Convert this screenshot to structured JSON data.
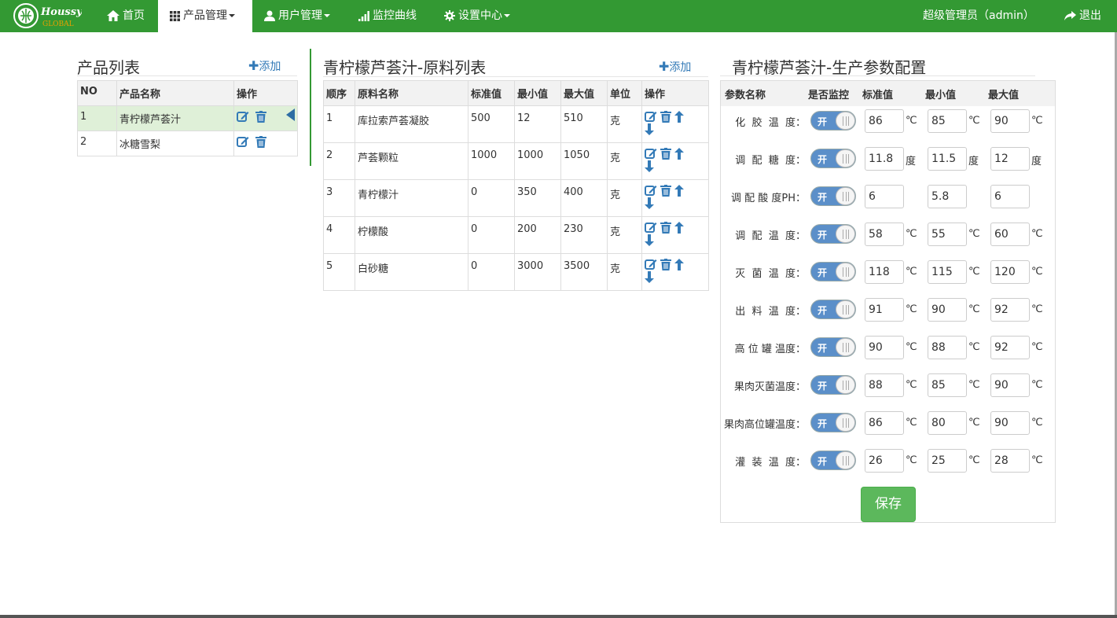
{
  "brand": {
    "logo_text": "Houssy",
    "logo_sub": "GLOBAL"
  },
  "nav": {
    "home": "首页",
    "product": "产品管理",
    "user": "用户管理",
    "monitor": "监控曲线",
    "settings": "设置中心",
    "admin": "超级管理员（admin）",
    "logout": "退出"
  },
  "products": {
    "title": "产品列表",
    "add": "添加",
    "headers": [
      "NO",
      "产品名称",
      "操作"
    ],
    "rows": [
      {
        "no": "1",
        "name": "青柠檬芦荟汁"
      },
      {
        "no": "2",
        "name": "冰糖雪梨"
      }
    ]
  },
  "materials": {
    "title": "青柠檬芦荟汁-原料列表",
    "add": "添加",
    "headers": [
      "顺序",
      "原料名称",
      "标准值",
      "最小值",
      "最大值",
      "单位",
      "操作"
    ],
    "rows": [
      {
        "seq": "1",
        "name": "库拉索芦荟凝胶",
        "std": "500",
        "min": "12",
        "max": "510",
        "unit": "克"
      },
      {
        "seq": "2",
        "name": "芦荟颗粒",
        "std": "1000",
        "min": "1000",
        "max": "1050",
        "unit": "克"
      },
      {
        "seq": "3",
        "name": "青柠檬汁",
        "std": "0",
        "min": "350",
        "max": "400",
        "unit": "克"
      },
      {
        "seq": "4",
        "name": "柠檬酸",
        "std": "0",
        "min": "200",
        "max": "230",
        "unit": "克"
      },
      {
        "seq": "5",
        "name": "白砂糖",
        "std": "0",
        "min": "3000",
        "max": "3500",
        "unit": "克"
      }
    ]
  },
  "params": {
    "title": "青柠檬芦荟汁-生产参数配置",
    "headers": [
      "参数名称",
      "是否监控",
      "标准值",
      "最小值",
      "最大值"
    ],
    "toggle_label": "开",
    "rows": [
      {
        "name": "化  胶  温  度：",
        "std": "86",
        "min": "85",
        "max": "90",
        "unit": "℃"
      },
      {
        "name": "调  配  糖  度：",
        "std": "11.8",
        "min": "11.5",
        "max": "12",
        "unit": "度"
      },
      {
        "name": "调 配 酸 度PH：",
        "std": "6",
        "min": "5.8",
        "max": "6",
        "unit": ""
      },
      {
        "name": "调  配  温  度：",
        "std": "58",
        "min": "55",
        "max": "60",
        "unit": "℃"
      },
      {
        "name": "灭  菌  温  度：",
        "std": "118",
        "min": "115",
        "max": "120",
        "unit": "℃"
      },
      {
        "name": "出  料  温  度：",
        "std": "91",
        "min": "90",
        "max": "92",
        "unit": "℃"
      },
      {
        "name": "高 位 罐 温度：",
        "std": "90",
        "min": "88",
        "max": "92",
        "unit": "℃"
      },
      {
        "name": "果肉灭菌温度：",
        "std": "88",
        "min": "85",
        "max": "90",
        "unit": "℃"
      },
      {
        "name": "果肉高位罐温度：",
        "std": "86",
        "min": "80",
        "max": "90",
        "unit": "℃"
      },
      {
        "name": "灌  装  温  度：",
        "std": "26",
        "min": "25",
        "max": "28",
        "unit": "℃"
      }
    ],
    "save": "保存"
  },
  "colors": {
    "nav_bg": "#339933",
    "accent": "#337ab7",
    "save": "#5cb85c",
    "selected_row": "#dff0d8"
  }
}
